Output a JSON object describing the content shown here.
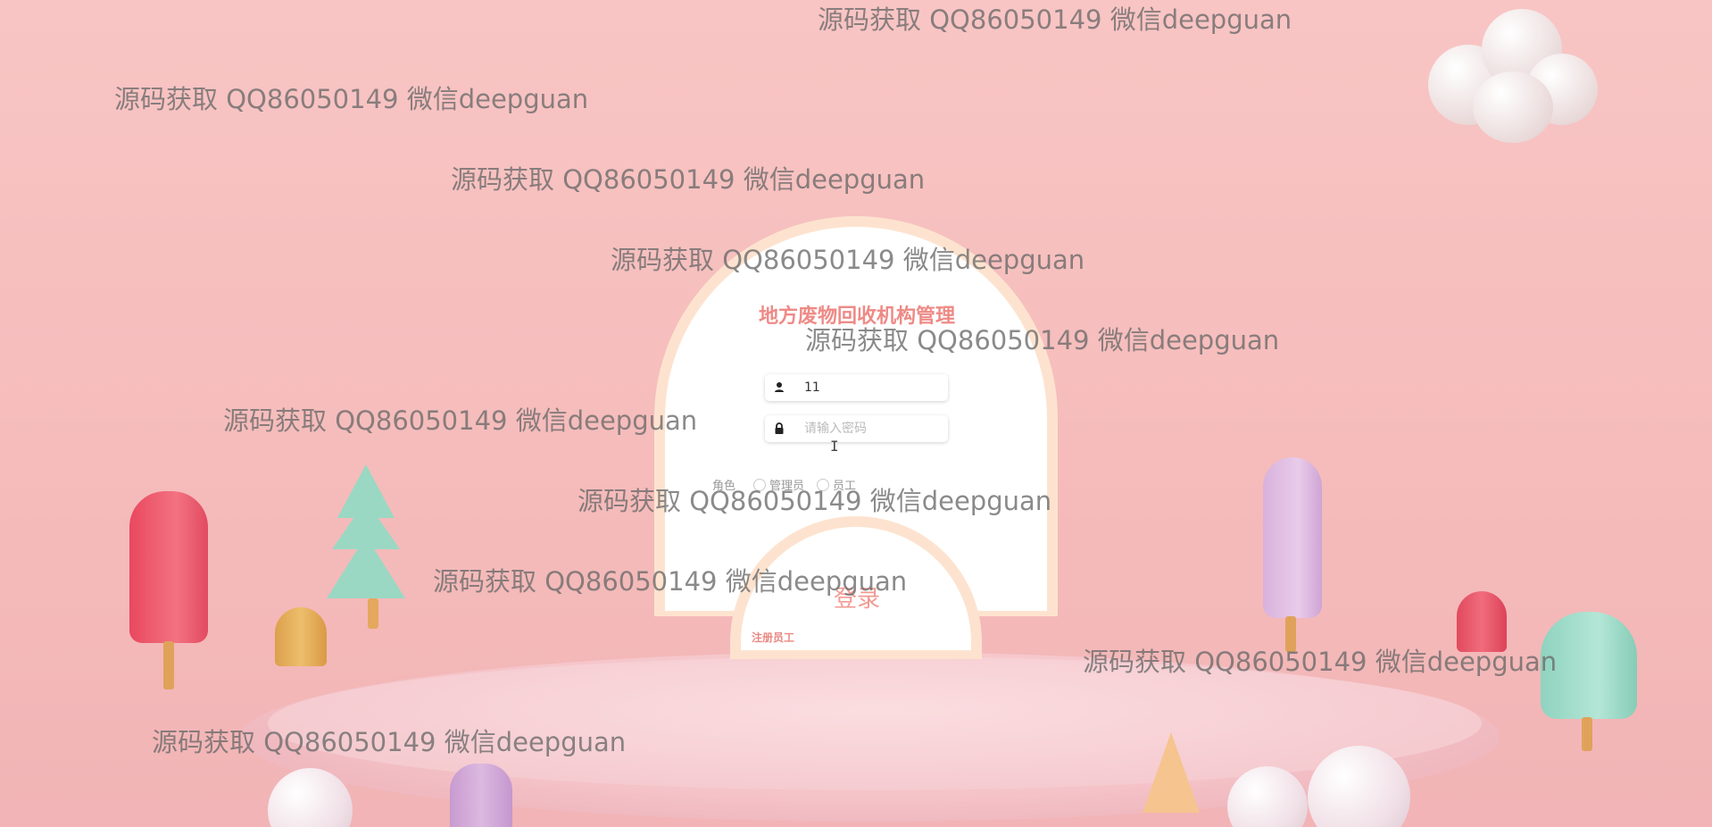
{
  "login": {
    "title": "地方废物回收机构管理",
    "username_value": "11",
    "password_placeholder": "请输入密码",
    "role_label": "角色",
    "role_options": [
      "管理员",
      "员工"
    ],
    "login_button": "登录",
    "register_link": "注册员工"
  },
  "watermarks": [
    "源码获取 QQ86050149 微信deepguan",
    "源码获取 QQ86050149 微信deepguan",
    "源码获取 QQ86050149 微信deepguan",
    "源码获取 QQ86050149 微信deepguan",
    "源码获取 QQ86050149 微信deepguan",
    "源码获取 QQ86050149 微信deepguan",
    "源码获取 QQ86050149 微信deepguan",
    "源码获取 QQ86050149 微信deepguan",
    "源码获取 QQ86050149 微信deepguan",
    "源码获取 QQ86050149 微信deepguan"
  ],
  "icons": {
    "user": "user-icon",
    "lock": "lock-icon"
  },
  "colors": {
    "accent": "#ee8a86",
    "background": "#f8c5c4",
    "arch_border": "#fde3cf"
  }
}
